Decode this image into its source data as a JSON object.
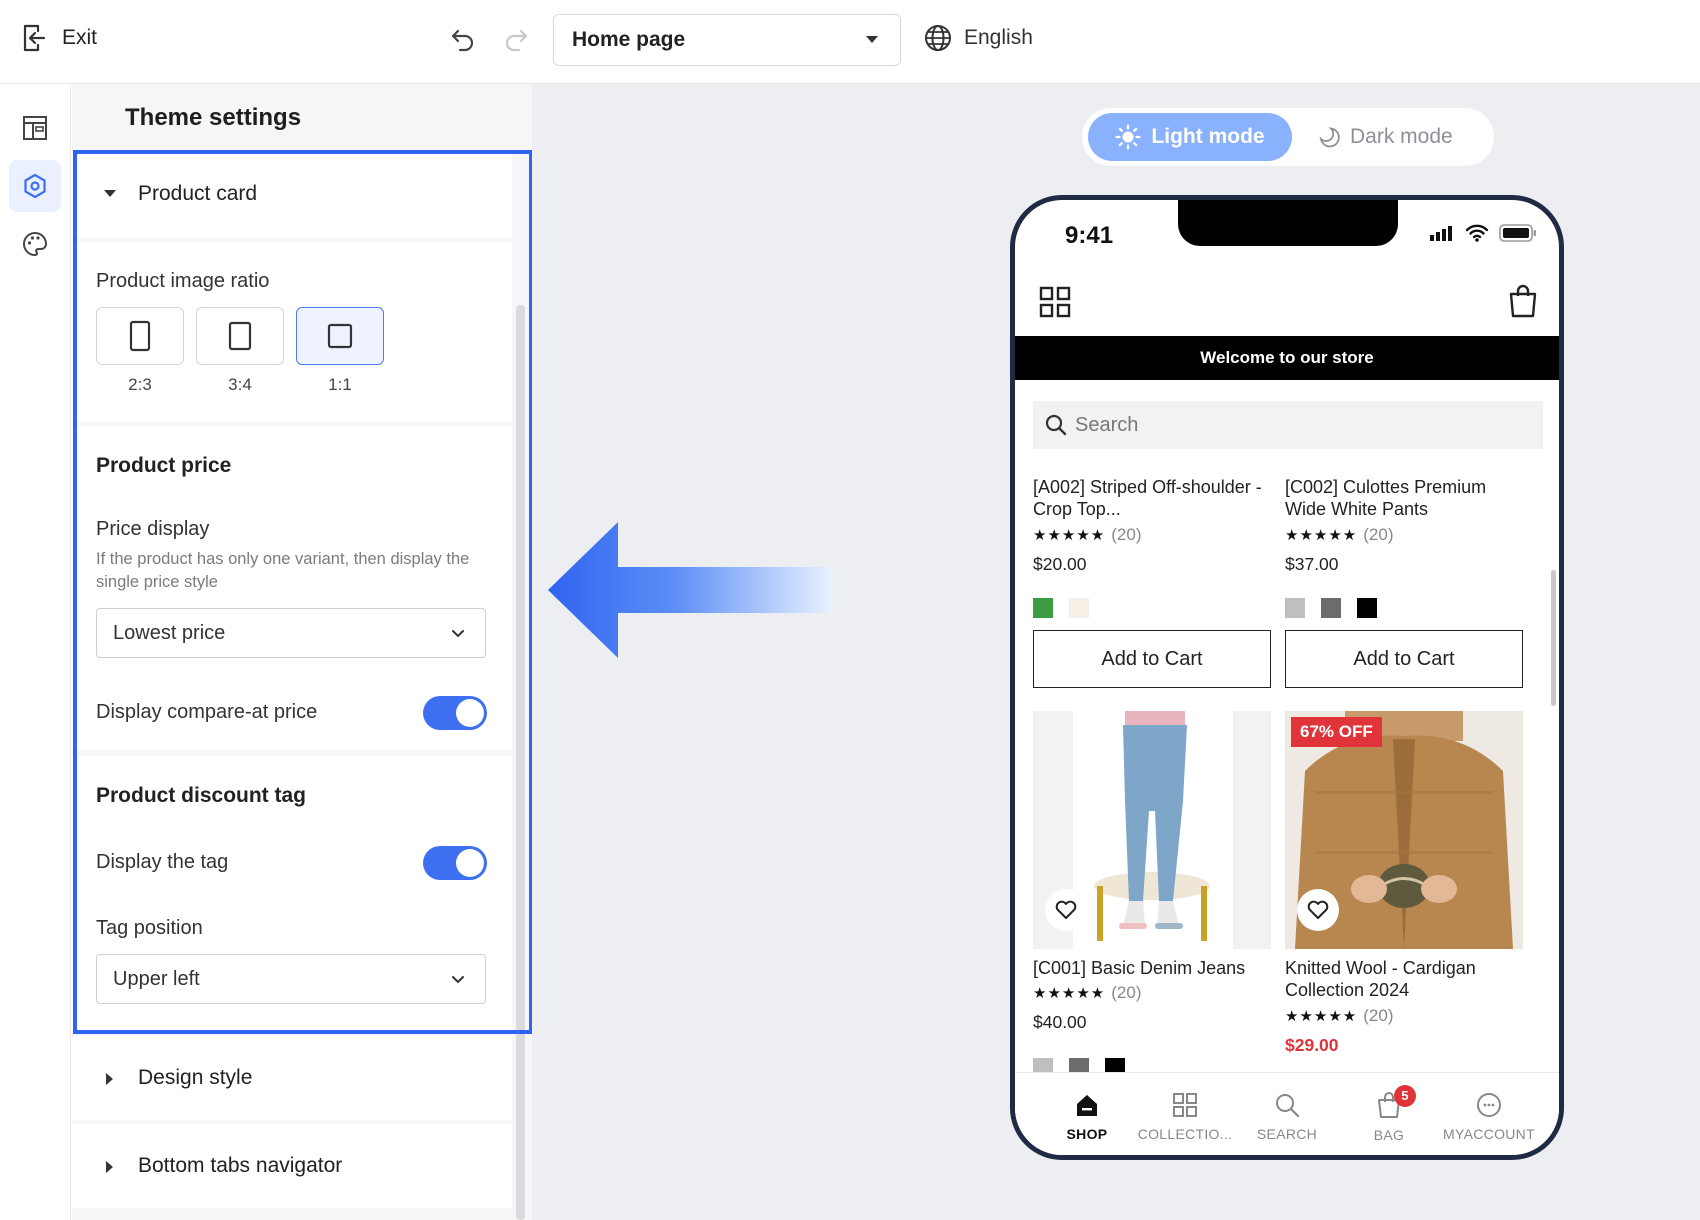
{
  "topbar": {
    "exit_label": "Exit",
    "page_select_value": "Home page",
    "language": "English"
  },
  "rail": {
    "icons": [
      "layout-icon",
      "theme-settings-icon",
      "palette-icon"
    ],
    "active": "theme-settings-icon"
  },
  "panel": {
    "title": "Theme settings",
    "product_card": {
      "header": "Product card",
      "image_ratio_label": "Product image ratio",
      "ratios": [
        "2:3",
        "3:4",
        "1:1"
      ],
      "selected_ratio": "1:1",
      "price_heading": "Product price",
      "price_display_label": "Price display",
      "price_display_help": "If the product has only one variant, then display the single price style",
      "price_display_value": "Lowest price",
      "compare_at_label": "Display compare-at price",
      "compare_at_enabled": true,
      "discount_heading": "Product discount tag",
      "display_tag_label": "Display the tag",
      "display_tag_enabled": true,
      "tag_position_label": "Tag position",
      "tag_position_value": "Upper left"
    },
    "collapsed_sections": [
      "Design style",
      "Bottom tabs navigator"
    ]
  },
  "preview": {
    "modes": {
      "light": "Light mode",
      "dark": "Dark mode",
      "active": "light"
    },
    "phone": {
      "time": "9:41",
      "banner": "Welcome to our store",
      "search_placeholder": "Search",
      "add_to_cart": "Add to Cart",
      "products": [
        {
          "name": "[A002] Striped Off-shoulder - Crop Top...",
          "rating_count": "(20)",
          "price": "$20.00",
          "swatches": [
            "#3d9b43",
            "#f7efe6"
          ]
        },
        {
          "name": "[C002] Culottes Premium Wide White Pants",
          "rating_count": "(20)",
          "price": "$37.00",
          "swatches": [
            "#bfbfbf",
            "#6c6c6c",
            "#000000"
          ]
        },
        {
          "name": "[C001] Basic Denim Jeans",
          "rating_count": "(20)",
          "price": "$40.00",
          "swatches": [
            "#bfbfbf",
            "#6c6c6c",
            "#000000"
          ]
        },
        {
          "name": "Knitted Wool - Cardigan Collection 2024",
          "rating_count": "(20)",
          "price": "$29.00",
          "discount_tag": "67% OFF"
        }
      ],
      "tabs": [
        "SHOP",
        "COLLECTIO...",
        "SEARCH",
        "BAG",
        "MYACCOUNT"
      ],
      "active_tab": "SHOP",
      "bag_count": "5"
    }
  },
  "colors": {
    "accent": "#2f64f0",
    "toggle_on": "#3d6ff0",
    "sale": "#e0343a",
    "phone_frame": "#1f2a44"
  }
}
